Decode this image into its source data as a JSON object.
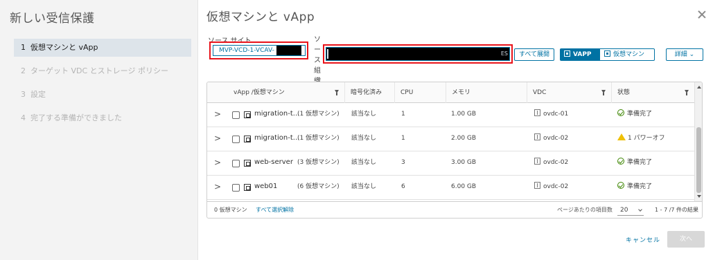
{
  "wizard": {
    "title": "新しい受信保護",
    "steps": [
      {
        "num": "1",
        "label": "仮想マシンと vApp"
      },
      {
        "num": "2",
        "label": "ターゲット VDC とストレージ ポリシー"
      },
      {
        "num": "3",
        "label": "設定"
      },
      {
        "num": "4",
        "label": "完了する準備ができました"
      }
    ]
  },
  "main": {
    "title": "仮想マシンと vApp",
    "source_site_label": "ソース サイト",
    "source_site_value": "MVP-VCD-1-VCAV-",
    "source_org_label": [
      "ソ",
      "ー",
      "ス",
      "組",
      "織"
    ],
    "source_org_tail": "ES",
    "expand_all": "すべて展開",
    "view_vapp": "VAPP",
    "view_vm": "仮想マシン",
    "details": "詳細"
  },
  "grid": {
    "headers": [
      "vApp /仮想マシン",
      "暗号化済み",
      "CPU",
      "メモリ",
      "VDC",
      "状態"
    ],
    "rows": [
      {
        "name": "migration-t...",
        "count": "(1 仮想マシン)",
        "encrypted": "該当なし",
        "cpu": "1",
        "memory": "1.00 GB",
        "vdc": "ovdc-01",
        "status": "準備完了",
        "status_type": "ok"
      },
      {
        "name": "migration-t...",
        "count": "(1 仮想マシン)",
        "encrypted": "該当なし",
        "cpu": "1",
        "memory": "2.00 GB",
        "vdc": "ovdc-02",
        "status": "1 パワーオフ",
        "status_type": "warn"
      },
      {
        "name": "web-server",
        "count": "(3 仮想マシン)",
        "encrypted": "該当なし",
        "cpu": "3",
        "memory": "3.00 GB",
        "vdc": "ovdc-02",
        "status": "準備完了",
        "status_type": "ok"
      },
      {
        "name": "web01",
        "count": "(6 仮想マシン)",
        "encrypted": "該当なし",
        "cpu": "6",
        "memory": "6.00 GB",
        "vdc": "ovdc-02",
        "status": "準備完了",
        "status_type": "ok"
      }
    ],
    "footer": {
      "selected": "0 仮想マシン",
      "deselect_all": "すべて選択解除",
      "per_page_label": "ページあたりの項目数",
      "per_page_value": "20",
      "count": "1 - 7 /7 件の結果"
    }
  },
  "actions": {
    "cancel": "キャンセル",
    "next": "次へ"
  },
  "colors": {
    "accent": "#0072a3",
    "highlight": "#e8121a",
    "ok": "#3c8500",
    "warn": "#efc006"
  }
}
